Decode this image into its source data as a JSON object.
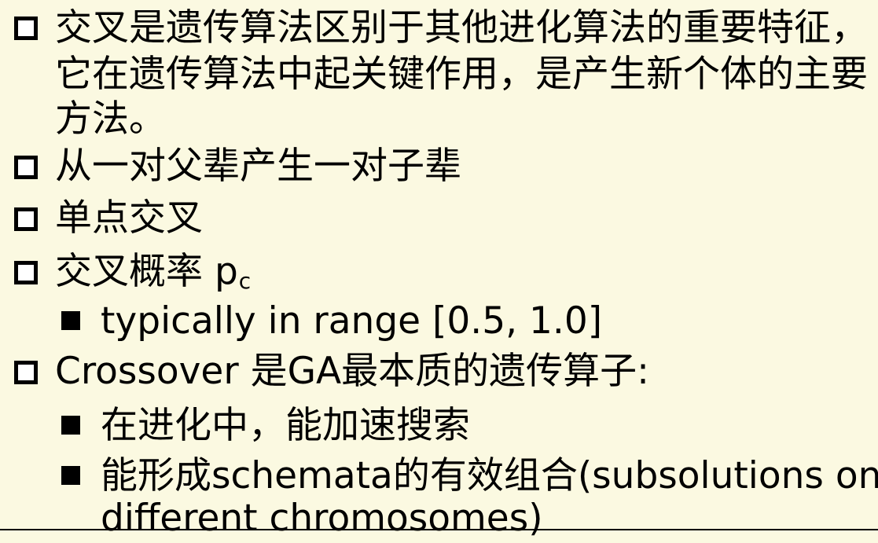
{
  "bullets": [
    {
      "lines": [
        "交叉是遗传算法区别于其他进化算法的重要特征，",
        "它在遗传算法中起关键作用，是产生新个体的主要",
        "方法。"
      ]
    },
    {
      "text": "从一对父辈产生一对子辈"
    },
    {
      "text": "单点交叉"
    },
    {
      "text": "交叉概率 p",
      "subscript": "c"
    },
    {
      "text": "typically in range [0.5, 1.0]"
    },
    {
      "text": "Crossover 是GA最本质的遗传算子:"
    },
    {
      "text": "在进化中，能加速搜索"
    },
    {
      "lines": [
        "能形成schemata的有效组合(subsolutions on",
        "different chromosomes)"
      ]
    }
  ]
}
